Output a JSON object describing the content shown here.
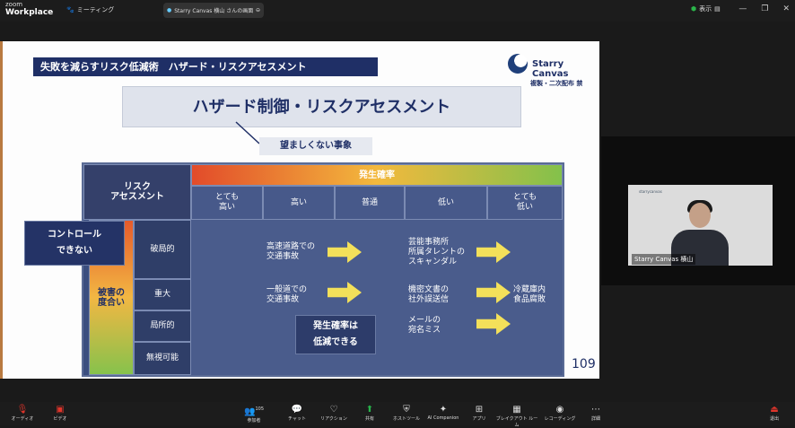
{
  "titlebar": {
    "app_line1": "zoom",
    "app_line2": "Workplace",
    "tab1_label": "ミーティング",
    "tab2_label": "Starry Canvas 横山 さんの画面",
    "view_label": "表示"
  },
  "slide": {
    "header": "失敗を減らすリスク低減術　ハザード・リスクアセスメント",
    "logo_text": "Starry Canvas",
    "copyright": "複製・二次配布 禁",
    "main_title": "ハザード制御・リスクアセスメント",
    "callout": "望ましくない事象",
    "page_number": "109",
    "matrix": {
      "risk_header": "リスク\nアセスメント",
      "prob_header": "発生確率",
      "columns": [
        "とても\n高い",
        "高い",
        "普通",
        "低い",
        "とても\n低い"
      ],
      "severity_label": "被害の\n度合い",
      "rows": [
        "破局的",
        "重大",
        "局所的",
        "無視可能"
      ],
      "cells": {
        "r1c2": "高速道路での\n交通事故",
        "r1c4": "芸能事務所\n所属タレントの\nスキャンダル",
        "r2c2": "一般道での\n交通事故",
        "r2c4": "機密文書の\n社外誤送信",
        "r2c5": "冷蔵庫内\n食品腐敗",
        "r3c4": "メールの\n宛名ミス"
      },
      "control_box": "コントロール\nできない",
      "reduce_box": "発生確率は\n低減できる"
    }
  },
  "video": {
    "name": "Starry Canvas 横山",
    "logo": "starrycanvas"
  },
  "toolbar": {
    "items": [
      "オーディオ",
      "ビデオ",
      "参加者",
      "チャット",
      "リアクション",
      "共有",
      "ホストツール",
      "AI Companion",
      "アプリ",
      "ブレイクアウト ルーム",
      "レコーディング",
      "詳細",
      "退出"
    ],
    "participants_count": "105"
  },
  "colors": {
    "navy": "#1f2f66",
    "share_green": "#27b24a",
    "leave_red": "#e0352b"
  }
}
